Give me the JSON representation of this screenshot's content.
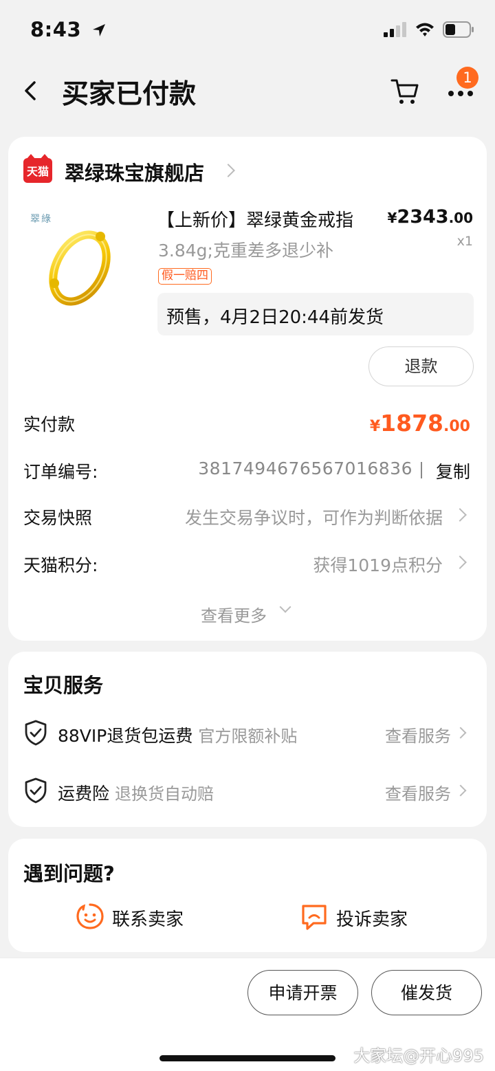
{
  "status_bar": {
    "time": "8:43"
  },
  "nav": {
    "title": "买家已付款",
    "badge_count": "1"
  },
  "shop": {
    "logo_text": "天猫",
    "name": "翠绿珠宝旗舰店"
  },
  "product": {
    "brand_mark": "翠綠",
    "title": "【上新价】翠绿黄金戒指",
    "spec": "3.84g;克重差多退少补",
    "tag": "假一赔四",
    "price_currency": "¥",
    "price_int": "2343",
    "price_dec": ".00",
    "qty": "x1",
    "presale": "预售，4月2日20:44前发货",
    "refund_label": "退款"
  },
  "payment": {
    "paid_label": "实付款",
    "currency": "¥",
    "amount_int": "1878",
    "amount_dec": ".00"
  },
  "order_info": {
    "order_no_label": "订单编号:",
    "order_no": "3817494676567016836",
    "copy_label": "复制",
    "snapshot_label": "交易快照",
    "snapshot_value": "发生交易争议时，可作为判断依据",
    "points_label": "天猫积分:",
    "points_value": "获得1019点积分",
    "see_more": "查看更多"
  },
  "services": {
    "title": "宝贝服务",
    "items": [
      {
        "name": "88VIP退货包运费",
        "desc": "官方限额补贴",
        "link": "查看服务"
      },
      {
        "name": "运费险",
        "desc": "退换货自动赔",
        "link": "查看服务"
      }
    ]
  },
  "help": {
    "title": "遇到问题?",
    "contact_label": "联系卖家",
    "complain_label": "投诉卖家"
  },
  "bottom": {
    "invoice_label": "申请开票",
    "urge_label": "催发货"
  },
  "watermark": "大家坛@开心995",
  "colors": {
    "accent": "#ff5a1f",
    "tmall_red": "#e6262b",
    "background": "#f2f2f2"
  },
  "icons": [
    "location-arrow-icon",
    "signal-icon",
    "wifi-icon",
    "battery-icon",
    "back-arrow-icon",
    "cart-icon",
    "more-icon",
    "chevron-right-icon",
    "chevron-down-icon",
    "shield-check-icon",
    "smiley-chat-icon",
    "complaint-chat-icon"
  ]
}
